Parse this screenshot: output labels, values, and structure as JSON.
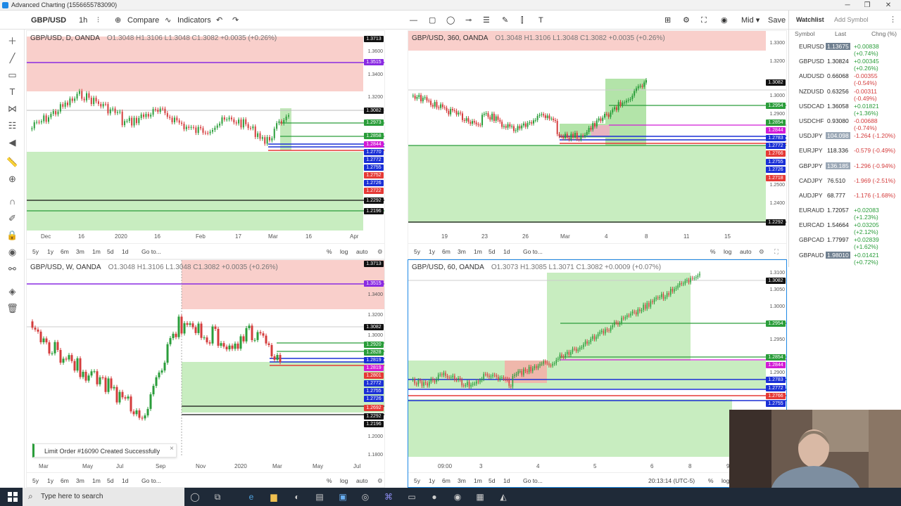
{
  "window": {
    "title": "Advanced Charting (1556655783090)",
    "controls": [
      "─",
      "❐",
      "✕"
    ]
  },
  "toolbar": {
    "symbol": "GBP/USD",
    "interval": "1h",
    "compare": "Compare",
    "indicators": "Indicators",
    "mid": "Mid",
    "save": "Save"
  },
  "panels": [
    {
      "legend": {
        "symbol": "GBP/USD, D, OANDA",
        "ohlc": "O1.3048 H1.3106 L1.3048 C1.3082 +0.0035 (+0.26%)"
      },
      "price_labels": [
        "1.3713",
        "1.3515",
        "1.3082",
        "1.2973",
        "1.2858",
        "1.2844",
        "1.2770",
        "1.2772",
        "1.2755",
        "1.2752",
        "1.2726",
        "1.2722",
        "1.2292",
        "1.2196"
      ],
      "price_ticks": [
        "1.3600",
        "1.3400",
        "1.3200",
        "1.2800",
        "1.2600",
        "1.2400"
      ],
      "time_axis": [
        "Dec",
        "16",
        "2020",
        "16",
        "Feb",
        "17",
        "Mar",
        "16",
        "Apr"
      ],
      "bottombar": [
        "5y",
        "1y",
        "6m",
        "3m",
        "1m",
        "5d",
        "1d",
        "Go to...",
        "%",
        "log",
        "auto"
      ]
    },
    {
      "legend": {
        "symbol": "GBP/USD, 360, OANDA",
        "ohlc": "O1.3048 H1.3106 L1.3048 C1.3082 +0.0035 (+0.26%)"
      },
      "price_labels": [
        "1.3082",
        "1.2954",
        "1.2854",
        "1.2844",
        "1.2783",
        "1.2772",
        "1.2766",
        "1.2755",
        "1.2726",
        "1.2718",
        "1.2292"
      ],
      "price_ticks": [
        "1.3300",
        "1.3200",
        "1.3000",
        "1.2900",
        "1.2500",
        "1.2400"
      ],
      "time_axis": [
        "19",
        "23",
        "26",
        "Mar",
        "4",
        "8",
        "11",
        "15"
      ],
      "bottombar": [
        "5y",
        "1y",
        "6m",
        "3m",
        "1m",
        "5d",
        "1d",
        "Go to...",
        "%",
        "log",
        "auto"
      ]
    },
    {
      "legend": {
        "symbol": "GBP/USD, W, OANDA",
        "ohlc": "O1.3048 H1.3106 L1.3048 C1.3082 +0.0035 (+0.26%)"
      },
      "price_labels": [
        "1.3713",
        "1.3515",
        "1.3082",
        "1.2920",
        "1.2828",
        "1.2819",
        "1.2819",
        "1.2801",
        "1.2772",
        "1.2755",
        "1.2726",
        "1.2692",
        "1.2292",
        "1.2196"
      ],
      "price_ticks": [
        "1.3400",
        "1.3200",
        "1.3000",
        "1.2000",
        "1.1800"
      ],
      "time_axis": [
        "Mar",
        "May",
        "Jul",
        "Sep",
        "Nov",
        "2020",
        "Mar",
        "May",
        "Jul"
      ],
      "bottombar": [
        "5y",
        "1y",
        "6m",
        "3m",
        "1m",
        "5d",
        "1d",
        "Go to...",
        "%",
        "log",
        "auto"
      ]
    },
    {
      "legend": {
        "symbol": "GBP/USD, 60, OANDA",
        "ohlc": "O1.3073 H1.3085 L1.3071 C1.3082 +0.0009 (+0.07%)"
      },
      "price_labels": [
        "1.3082",
        "1.2954",
        "1.2854",
        "1.2844",
        "1.2783",
        "1.2772",
        "1.2766",
        "1.2755"
      ],
      "price_ticks": [
        "1.3100",
        "1.3050",
        "1.3000",
        "1.2950",
        "1.2900",
        "1.2850",
        "1.2800"
      ],
      "time_axis": [
        "09:00",
        "3",
        "4",
        "5",
        "6",
        "8",
        "9"
      ],
      "bottombar": [
        "5y",
        "1y",
        "6m",
        "3m",
        "1m",
        "5d",
        "1d",
        "Go to...",
        "20:13:14 (UTC-5)",
        "%",
        "log"
      ]
    }
  ],
  "watchlist": {
    "tab": "Watchlist",
    "add": "Add Symbol",
    "headers": [
      "Symbol",
      "Last",
      "Chng (%)"
    ],
    "rows": [
      {
        "s": "EURUSD",
        "l": "1.13675",
        "c": "+0.00838 (+0.74%)",
        "hl": true
      },
      {
        "s": "GBPUSD",
        "l": "1.30824",
        "c": "+0.00345 (+0.26%)",
        "hl": false
      },
      {
        "s": "AUDUSD",
        "l": "0.66068",
        "c": "-0.00355 (-0.54%)",
        "hl": false
      },
      {
        "s": "NZDUSD",
        "l": "0.63256",
        "c": "-0.00311 (-0.49%)",
        "hl": false
      },
      {
        "s": "USDCAD",
        "l": "1.36058",
        "c": "+0.01821 (+1.36%)",
        "hl": false
      },
      {
        "s": "USDCHF",
        "l": "0.93080",
        "c": "-0.00688 (-0.74%)",
        "hl": false
      },
      {
        "s": "USDJPY",
        "l": "104.098",
        "c": "-1.264 (-1.20%)",
        "hl": true
      },
      {
        "s": "EURJPY",
        "l": "118.336",
        "c": "-0.579 (-0.49%)",
        "hl": false
      },
      {
        "s": "GBPJPY",
        "l": "136.185",
        "c": "-1.296 (-0.94%)",
        "hl": true
      },
      {
        "s": "CADJPY",
        "l": "76.510",
        "c": "-1.969 (-2.51%)",
        "hl": false
      },
      {
        "s": "AUDJPY",
        "l": "68.777",
        "c": "-1.176 (-1.68%)",
        "hl": false
      },
      {
        "s": "EURAUD",
        "l": "1.72057",
        "c": "+0.02083 (+1.23%)",
        "hl": false
      },
      {
        "s": "EURCAD",
        "l": "1.54664",
        "c": "+0.03205 (+2.12%)",
        "hl": false
      },
      {
        "s": "GBPCAD",
        "l": "1.77997",
        "c": "+0.02839 (+1.62%)",
        "hl": false
      },
      {
        "s": "GBPAUD",
        "l": "1.98010",
        "c": "+0.01421 (+0.72%)",
        "hl": true
      }
    ]
  },
  "toast": {
    "message": "Limit Order #16090 Created Successfully",
    "close": "×"
  },
  "taskbar": {
    "search_placeholder": "Type here to search"
  },
  "colors": {
    "up": "#2a9d3a",
    "down": "#d43c3c",
    "zone_green": "#b9e7b1",
    "zone_red": "#f7c6c3",
    "level_blue": "#1a2fd6",
    "level_purple": "#8a2be2",
    "level_red": "#e53935",
    "level_black": "#111111",
    "label_magenta": "#d21bd6"
  }
}
